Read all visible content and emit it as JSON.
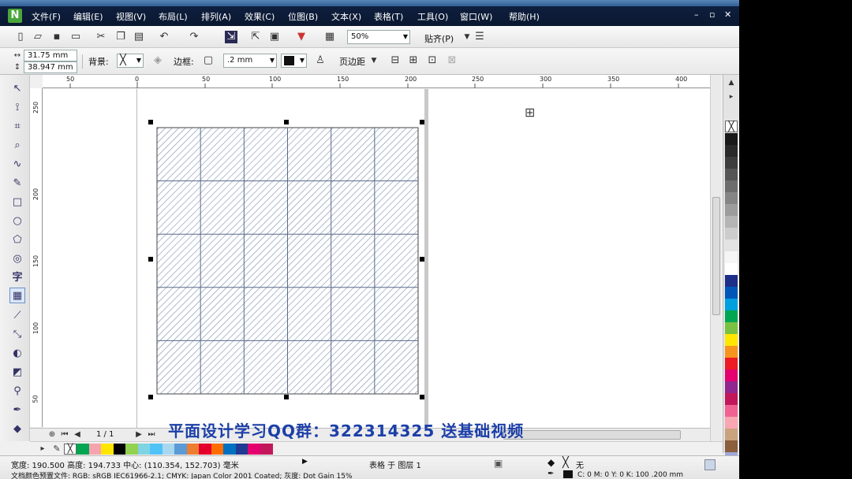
{
  "menu": {
    "items": [
      "文件(F)",
      "编辑(E)",
      "视图(V)",
      "布局(L)",
      "排列(A)",
      "效果(C)",
      "位图(B)",
      "文本(X)",
      "表格(T)",
      "工具(O)",
      "窗口(W)",
      "帮助(H)"
    ]
  },
  "toolbar": {
    "zoom_value": "50%",
    "snap_label": "贴齐(P)"
  },
  "property_bar": {
    "width_value": "31.75 mm",
    "height_value": "38.947 mm",
    "background_label": "背景:",
    "border_label": "边框:",
    "border_width": ".2 mm",
    "margin_label": "页边距"
  },
  "rulers": {
    "horizontal_ticks": [
      "50",
      "0",
      "50",
      "100",
      "150",
      "200",
      "250",
      "300",
      "350",
      "400"
    ],
    "vertical_ticks": [
      "250",
      "200",
      "150",
      "100",
      "50"
    ],
    "unit_label": "毫米"
  },
  "table": {
    "rows": 5,
    "cols": 6,
    "fill_pattern": "diagonal-hatch",
    "line_color": "#7a8fb0"
  },
  "document_nav": {
    "page_indicator": "1 / 1"
  },
  "overlay_text": "平面设计学习QQ群：322314325 送基础视频",
  "status": {
    "dimensions": "宽度: 190.500 高度: 194.733 中心: (110.354, 152.703) 毫米",
    "object_info": "表格 于 图层 1",
    "fill_label": "无",
    "color_profile": "文档颜色预置文件: RGB: sRGB IEC61966-2.1; CMYK: Japan Color 2001 Coated; 灰度: Dot Gain 15%",
    "outline_info": "C: 0 M: 0 Y: 0 K: 100 .200 mm"
  },
  "palette_colors": [
    "#1a1a1a",
    "#2a2a2a",
    "#3d3d3d",
    "#555555",
    "#6d6d6d",
    "#858585",
    "#9c9c9c",
    "#b4b4b4",
    "#cccccc",
    "#e3e3e3",
    "#f5f5f5",
    "#ffffff",
    "#1e2f8a",
    "#0057b8",
    "#00a0e0",
    "#00a651",
    "#7ac143",
    "#ffe600",
    "#f7941d",
    "#ed1c24",
    "#e4006e",
    "#92278f",
    "#c2185b",
    "#f06292",
    "#f8a6b1",
    "#c9a27e",
    "#8b5e3c",
    "#9fa8da",
    "#7986cb",
    "#5c6bc0",
    "#b0b0b0"
  ],
  "colorbar_swatches": [
    "#00a651",
    "#f6a3b0",
    "#ffe600",
    "#000000",
    "#92d050",
    "#7fd4e3",
    "#4fc3f7",
    "#a7d8f0",
    "#5b9bd5",
    "#ed7d31",
    "#e4002b",
    "#ff6d00",
    "#0070c0",
    "#1f3a93",
    "#e4006e",
    "#c2185b"
  ]
}
